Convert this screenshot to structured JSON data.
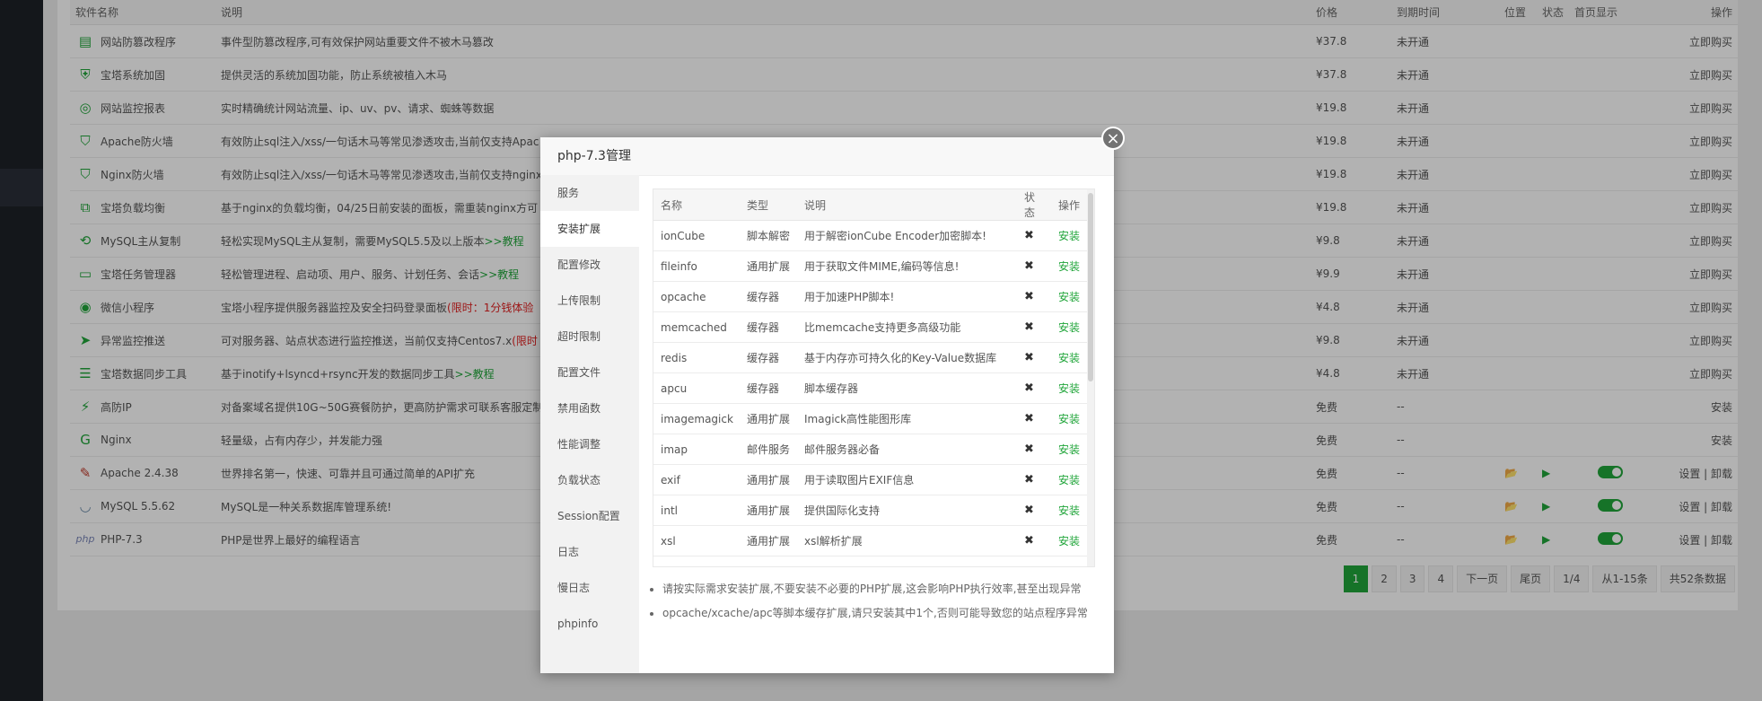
{
  "table": {
    "headers": [
      "软件名称",
      "说明",
      "价格",
      "到期时间",
      "位置",
      "状态",
      "首页显示",
      "操作"
    ],
    "rows": [
      {
        "icon": "tamper-proof-icon",
        "name": "网站防篡改程序",
        "desc": "事件型防篡改程序,可有效保护网站重要文件不被木马篡改",
        "price": "¥37.8",
        "expire": "未开通",
        "action": "立即购买"
      },
      {
        "icon": "shield-icon",
        "name": "宝塔系统加固",
        "desc": "提供灵活的系统加固功能，防止系统被植入木马",
        "price": "¥37.8",
        "expire": "未开通",
        "action": "立即购买"
      },
      {
        "icon": "globe-icon",
        "name": "网站监控报表",
        "desc": "实时精确统计网站流量、ip、uv、pv、请求、蜘蛛等数据",
        "price": "¥19.8",
        "expire": "未开通",
        "action": "立即购买"
      },
      {
        "icon": "waf-icon",
        "name": "Apache防火墙",
        "desc": "有效防止sql注入/xss/一句话木马等常见渗透攻击,当前仅支持Apac",
        "price": "¥19.8",
        "expire": "未开通",
        "action": "立即购买"
      },
      {
        "icon": "waf-icon",
        "name": "Nginx防火墙",
        "desc": "有效防止sql注入/xss/一句话木马等常见渗透攻击,当前仅支持nginx",
        "price": "¥19.8",
        "expire": "未开通",
        "action": "立即购买"
      },
      {
        "icon": "network-icon",
        "name": "宝塔负载均衡",
        "desc": "基于nginx的负载均衡，04/25日前安装的面板，需重装nginx方可",
        "price": "¥19.8",
        "expire": "未开通",
        "action": "立即购买"
      },
      {
        "icon": "sync-icon",
        "name": "MySQL主从复制",
        "desc": "轻松实现MySQL主从复制，需要MySQL5.5及以上版本",
        "desc_extra": ">>教程",
        "price": "¥9.8",
        "expire": "未开通",
        "action": "立即购买"
      },
      {
        "icon": "monitor-icon",
        "name": "宝塔任务管理器",
        "desc": "轻松管理进程、启动项、用户、服务、计划任务、会话",
        "desc_extra": ">>教程",
        "price": "¥9.9",
        "expire": "未开通",
        "action": "立即购买"
      },
      {
        "icon": "miniprogram-icon",
        "name": "微信小程序",
        "desc": "宝塔小程序提供服务器监控及安全扫码登录面板",
        "desc_red": "(限时：1分钱体验",
        "price": "¥4.8",
        "expire": "未开通",
        "action": "立即购买"
      },
      {
        "icon": "alert-push-icon",
        "name": "异常监控推送",
        "desc": "可对服务器、站点状态进行监控推送，当前仅支持Centos7.x",
        "desc_red": "(限时",
        "price": "¥9.8",
        "expire": "未开通",
        "action": "立即购买"
      },
      {
        "icon": "database-sync-icon",
        "name": "宝塔数据同步工具",
        "desc": "基于inotify+lsyncd+rsync开发的数据同步工具",
        "desc_extra": ">>教程",
        "price": "¥4.8",
        "expire": "未开通",
        "action": "立即购买"
      },
      {
        "icon": "ddos-shield-icon",
        "name": "高防IP",
        "desc": "对备案域名提供10G~50G赛餐防护，更高防护需求可联系客服定制",
        "price": "免费",
        "expire": "--",
        "action": "安装"
      },
      {
        "icon": "nginx-icon",
        "name": "Nginx",
        "desc": "轻量级，占有内存少，并发能力强",
        "price": "免费",
        "expire": "--",
        "action": "安装"
      },
      {
        "icon": "apache-feather-icon",
        "name": "Apache 2.4.38",
        "desc": "世界排名第一，快速、可靠并且可通过简单的API扩充",
        "price": "免费",
        "expire": "--",
        "action": "设置 | 卸载",
        "installed": true
      },
      {
        "icon": "mysql-dolphin-icon",
        "name": "MySQL 5.5.62",
        "desc": "MySQL是一种关系数据库管理系统!",
        "price": "免费",
        "expire": "--",
        "action": "设置 | 卸载",
        "installed": true
      },
      {
        "icon": "php-icon",
        "name": "PHP-7.3",
        "desc": "PHP是世界上最好的编程语言",
        "price": "免费",
        "expire": "--",
        "action": "设置 | 卸载",
        "installed": true
      }
    ]
  },
  "pager": {
    "pages": [
      "1",
      "2",
      "3",
      "4"
    ],
    "next": "下一页",
    "last": "尾页",
    "page_info": "1/4",
    "range": "从1-15条",
    "total": "共52条数据"
  },
  "modal": {
    "title": "php-7.3管理",
    "close_symbol": "×",
    "menu": [
      "服务",
      "安装扩展",
      "配置修改",
      "上传限制",
      "超时限制",
      "配置文件",
      "禁用函数",
      "性能调整",
      "负载状态",
      "Session配置",
      "日志",
      "慢日志",
      "phpinfo"
    ],
    "active_menu": "安装扩展",
    "ext_headers": [
      "名称",
      "类型",
      "说明",
      "状态",
      "操作"
    ],
    "extensions": [
      {
        "name": "ionCube",
        "type": "脚本解密",
        "desc": "用于解密ionCube Encoder加密脚本!",
        "status": "✖",
        "action": "安装"
      },
      {
        "name": "fileinfo",
        "type": "通用扩展",
        "desc": "用于获取文件MIME,编码等信息!",
        "status": "✖",
        "action": "安装"
      },
      {
        "name": "opcache",
        "type": "缓存器",
        "desc": "用于加速PHP脚本!",
        "status": "✖",
        "action": "安装"
      },
      {
        "name": "memcached",
        "type": "缓存器",
        "desc": "比memcache支持更多高级功能",
        "status": "✖",
        "action": "安装"
      },
      {
        "name": "redis",
        "type": "缓存器",
        "desc": "基于内存亦可持久化的Key-Value数据库",
        "status": "✖",
        "action": "安装"
      },
      {
        "name": "apcu",
        "type": "缓存器",
        "desc": "脚本缓存器",
        "status": "✖",
        "action": "安装"
      },
      {
        "name": "imagemagick",
        "type": "通用扩展",
        "desc": "Imagick高性能图形库",
        "status": "✖",
        "action": "安装"
      },
      {
        "name": "imap",
        "type": "邮件服务",
        "desc": "邮件服务器必备",
        "status": "✖",
        "action": "安装"
      },
      {
        "name": "exif",
        "type": "通用扩展",
        "desc": "用于读取图片EXIF信息",
        "status": "✖",
        "action": "安装"
      },
      {
        "name": "intl",
        "type": "通用扩展",
        "desc": "提供国际化支持",
        "status": "✖",
        "action": "安装"
      },
      {
        "name": "xsl",
        "type": "通用扩展",
        "desc": "xsl解析扩展",
        "status": "✖",
        "action": "安装"
      }
    ],
    "notes": [
      "请按实际需求安装扩展,不要安装不必要的PHP扩展,这会影响PHP执行效率,甚至出现异常",
      "opcache/xcache/apc等脚本缓存扩展,请只安装其中1个,否则可能导致您的站点程序异常"
    ]
  },
  "colors": {
    "accent": "#20a53a",
    "price": "#f0592b",
    "sidebar": "#1d2128"
  }
}
